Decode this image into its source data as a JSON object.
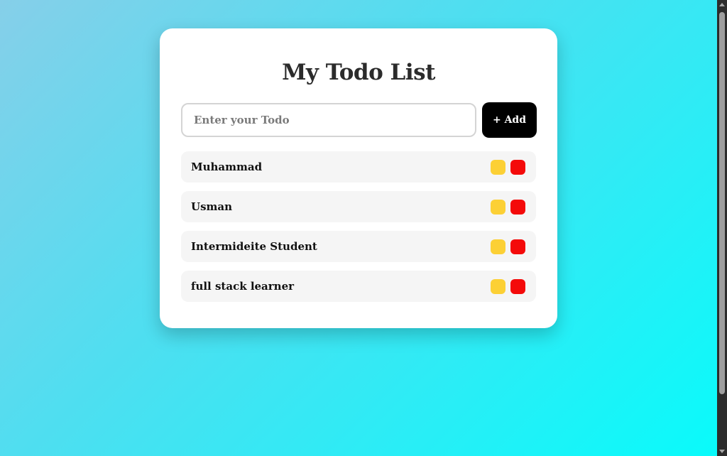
{
  "app": {
    "title": "My Todo List"
  },
  "input": {
    "placeholder": "Enter your Todo",
    "value": ""
  },
  "add_button": {
    "label": "+ Add"
  },
  "todos": [
    {
      "text": "Muhammad"
    },
    {
      "text": "Usman"
    },
    {
      "text": "Intermideite Student"
    },
    {
      "text": "full stack learner"
    }
  ],
  "colors": {
    "background_start": "#86cfe9",
    "background_end": "#08fbfb",
    "card": "#ffffff",
    "add_button": "#000000",
    "edit_button": "#fcd035",
    "delete_button": "#f40a0a",
    "item_background": "#f5f5f5"
  },
  "icons": {
    "edit": "edit-button-yellow-square",
    "delete": "delete-button-red-square"
  }
}
